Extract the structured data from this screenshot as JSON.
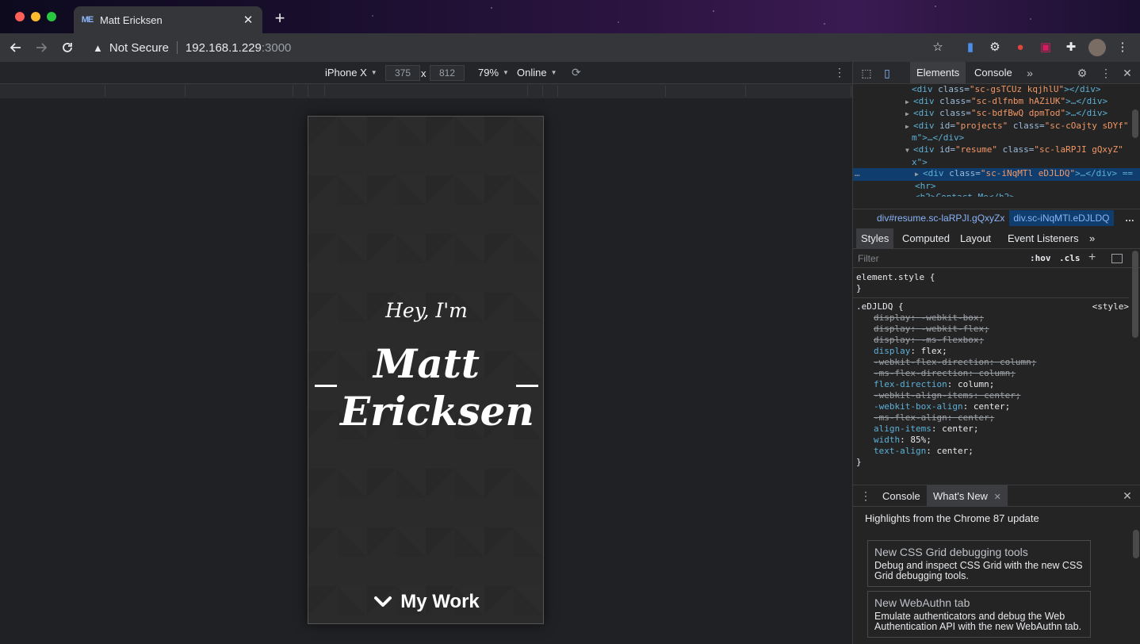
{
  "browser": {
    "tab_title": "Matt Ericksen",
    "favicon_text": "ME",
    "address": {
      "security_label": "Not Secure",
      "host": "192.168.1.229",
      "port": ":3000"
    }
  },
  "device_toolbar": {
    "device": "iPhone X",
    "width": "375",
    "times": "x",
    "height": "812",
    "zoom": "79%",
    "network": "Online"
  },
  "page": {
    "greeting": "Hey, I'm",
    "name": "Matt Ericksen",
    "cta": "My Work"
  },
  "devtools": {
    "tabs": [
      "Elements",
      "Console"
    ],
    "dom_lines": [
      {
        "indent": 0,
        "arrow": "",
        "open": "<div ",
        "attrs": [
          [
            "class",
            "sc-gsTCUz kqjhlU"
          ]
        ],
        "close": "></div>"
      },
      {
        "indent": 0,
        "arrow": "▶",
        "open": "<div ",
        "attrs": [
          [
            "class",
            "sc-dlfnbm hAZiUK"
          ]
        ],
        "close": ">…</div>"
      },
      {
        "indent": 0,
        "arrow": "▶",
        "open": "<div ",
        "attrs": [
          [
            "class",
            "sc-bdfBwQ dpmTod"
          ]
        ],
        "close": ">…</div>"
      },
      {
        "indent": 0,
        "arrow": "▶",
        "open": "<div ",
        "attrs": [
          [
            "id",
            "projects"
          ],
          [
            "class",
            "sc-cOajty sDYf"
          ]
        ],
        "close": ""
      },
      {
        "indent": 0,
        "arrow": "",
        "open": "m\">…</div>",
        "attrs": [],
        "close": ""
      },
      {
        "indent": 0,
        "arrow": "▼",
        "open": "<div ",
        "attrs": [
          [
            "id",
            "resume"
          ],
          [
            "class",
            "sc-laRPJI gQxyZ"
          ]
        ],
        "close": ""
      },
      {
        "indent": 0,
        "arrow": "",
        "open": "x\">",
        "attrs": [],
        "close": ""
      },
      {
        "indent": 1,
        "arrow": "▶",
        "open": "<div ",
        "attrs": [
          [
            "class",
            "sc-iNqMTl eDJLDQ"
          ]
        ],
        "close": ">…</div> =="
      },
      {
        "indent": 1,
        "arrow": "",
        "open": "<hr>",
        "attrs": [],
        "close": ""
      },
      {
        "indent": 1,
        "arrow": "",
        "open": "<h2>Contact Me</h2>",
        "attrs": [],
        "close": ""
      }
    ],
    "breadcrumbs": [
      "div#resume.sc-laRPJI.gQxyZx",
      "div.sc-iNqMTl.eDJLDQ"
    ],
    "sub_tabs": [
      "Styles",
      "Computed",
      "Layout",
      "Event Listeners"
    ],
    "filter_placeholder": "Filter",
    "hov": ":hov",
    "cls": ".cls",
    "element_style": "element.style {",
    "close_brace": "}",
    "rule_selector": ".eDJLDQ {",
    "rule_source": "<style>",
    "declarations": [
      {
        "name": "display",
        "value": "-webkit-box",
        "struck": true
      },
      {
        "name": "display",
        "value": "-webkit-flex",
        "struck": true
      },
      {
        "name": "display",
        "value": "-ms-flexbox",
        "struck": true
      },
      {
        "name": "display",
        "value": "flex",
        "struck": false
      },
      {
        "name": "-webkit-flex-direction",
        "value": "column",
        "struck": true
      },
      {
        "name": "-ms-flex-direction",
        "value": "column",
        "struck": true
      },
      {
        "name": "flex-direction",
        "value": "column",
        "struck": false
      },
      {
        "name": "-webkit-align-items",
        "value": "center",
        "struck": true
      },
      {
        "name": "-webkit-box-align",
        "value": "center",
        "struck": false
      },
      {
        "name": "-ms-flex-align",
        "value": "center",
        "struck": true
      },
      {
        "name": "align-items",
        "value": "center",
        "struck": false
      },
      {
        "name": "width",
        "value": "85%",
        "struck": false
      },
      {
        "name": "text-align",
        "value": "center",
        "struck": false
      }
    ],
    "drawer": {
      "tabs": [
        "Console",
        "What's New"
      ],
      "headline": "Highlights from the Chrome 87 update",
      "cards": [
        {
          "title": "New CSS Grid debugging tools",
          "desc": "Debug and inspect CSS Grid with the new CSS Grid debugging tools."
        },
        {
          "title": "New WebAuthn tab",
          "desc": "Emulate authenticators and debug the Web Authentication API with the new WebAuthn tab."
        }
      ]
    }
  }
}
